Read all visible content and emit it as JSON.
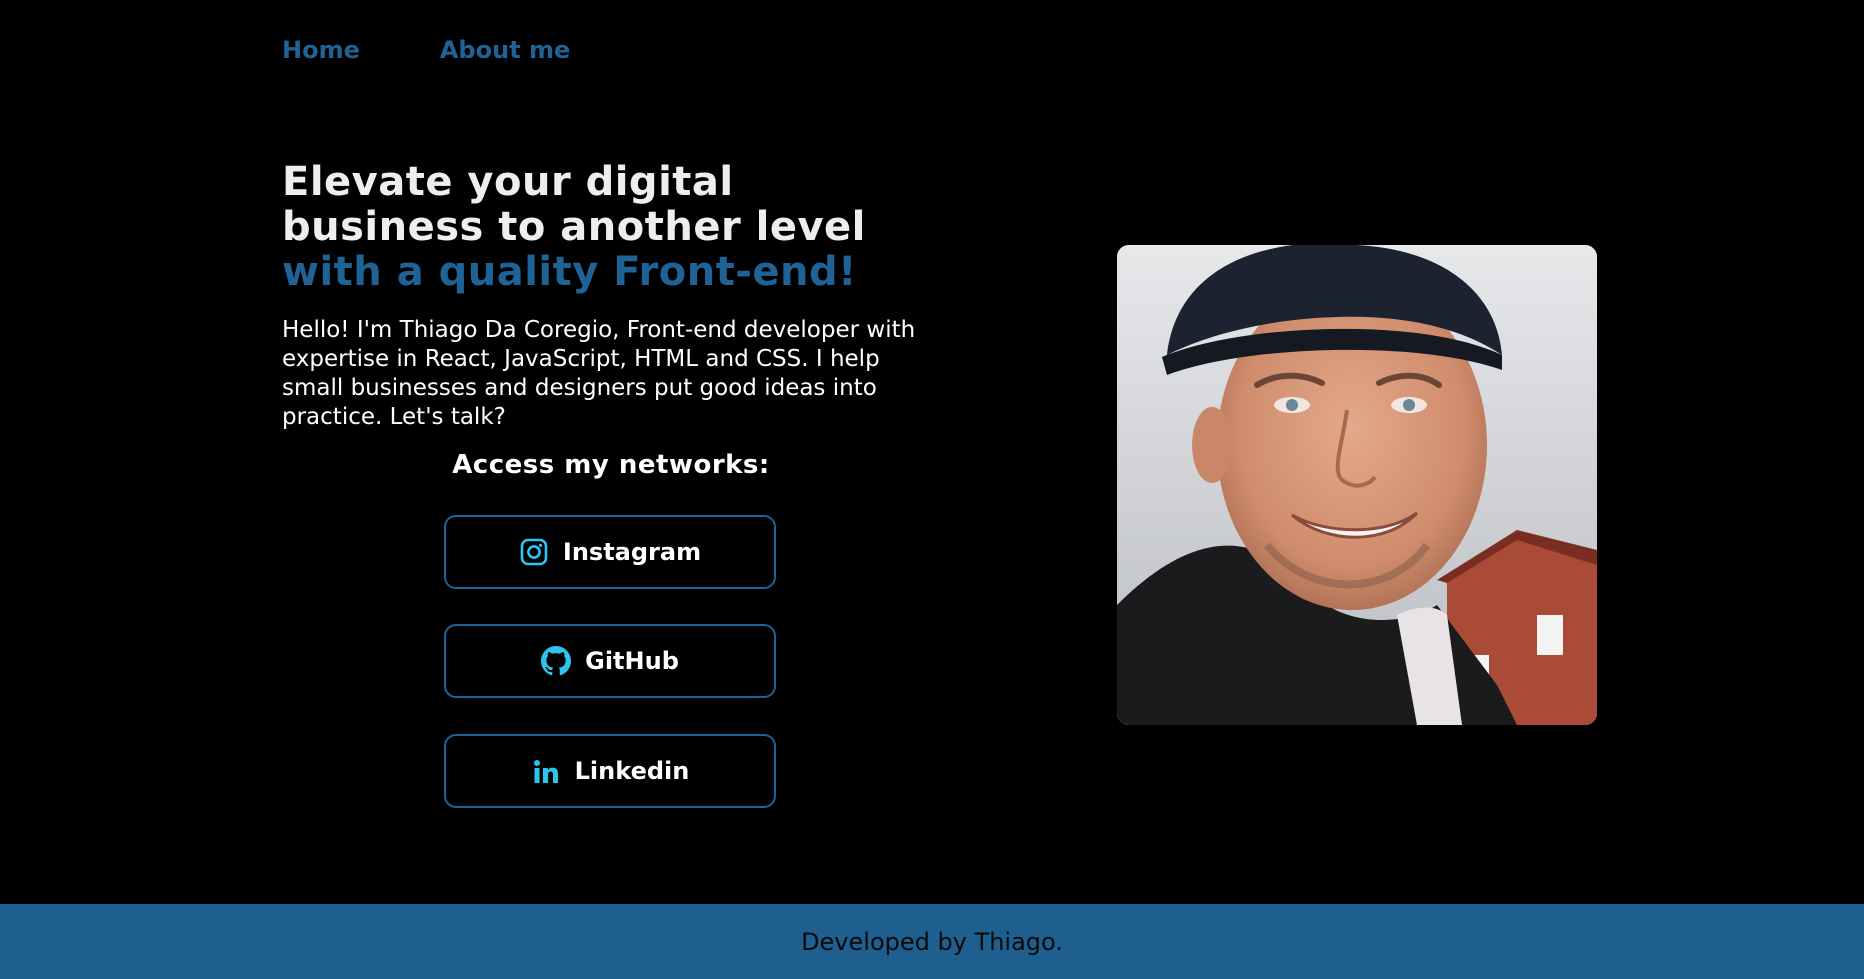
{
  "nav": {
    "items": [
      {
        "label": "Home"
      },
      {
        "label": "About me"
      }
    ]
  },
  "hero": {
    "title_line1": "Elevate your digital",
    "title_line2": "business to another level",
    "title_accent": "with a quality Front-end!",
    "intro": "Hello! I'm Thiago Da Coregio, Front-end developer with expertise in React, JavaScript, HTML and CSS. I help small businesses and designers put good ideas into practice. Let's talk?"
  },
  "networks": {
    "title": "Access my networks:",
    "buttons": [
      {
        "label": "Instagram",
        "icon": "instagram-icon"
      },
      {
        "label": "GitHub",
        "icon": "github-icon"
      },
      {
        "label": "Linkedin",
        "icon": "linkedin-icon"
      }
    ]
  },
  "footer": {
    "text": "Developed by Thiago."
  },
  "colors": {
    "background": "#000000",
    "accent": "#1f6296",
    "icon": "#2ec4f0",
    "footer": "#1f5f8f"
  }
}
